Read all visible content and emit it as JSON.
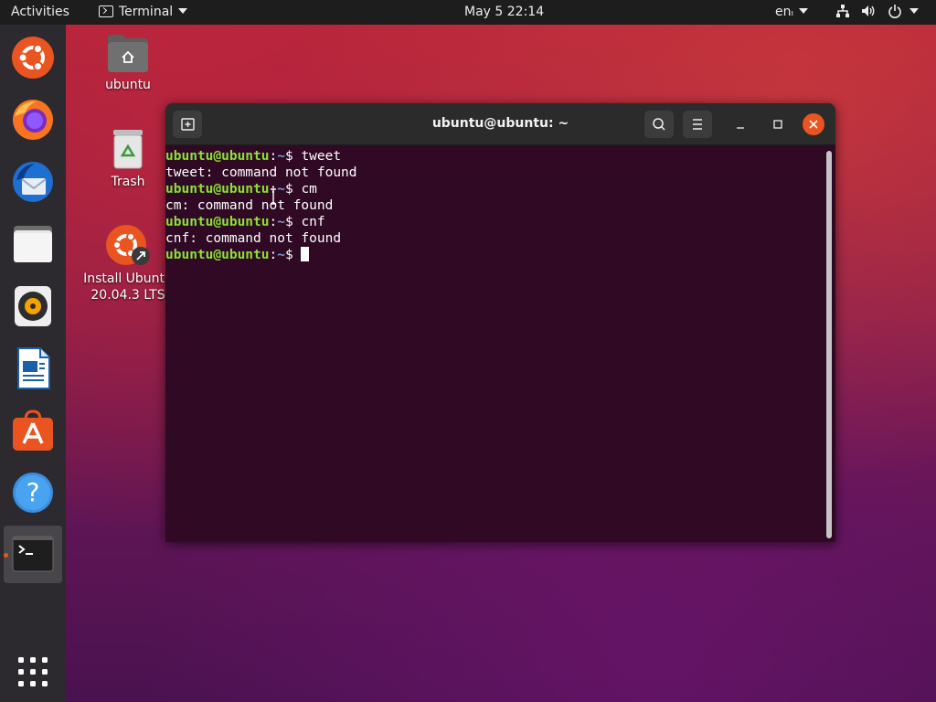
{
  "topbar": {
    "activities": "Activities",
    "app_name": "Terminal",
    "clock": "May 5  22:14",
    "language": "en"
  },
  "dock": {
    "items": [
      "ubuntu-software-icon",
      "firefox-icon",
      "thunderbird-icon",
      "files-icon",
      "rhythmbox-icon",
      "libreoffice-writer-icon",
      "ubuntu-software-center-icon",
      "help-icon",
      "terminal-icon",
      "show-applications-icon"
    ]
  },
  "desktop": {
    "home_label": "ubuntu",
    "trash_label": "Trash",
    "installer_label_line1": "Install Ubuntu",
    "installer_label_line2": "20.04.3 LTS"
  },
  "terminal": {
    "title": "ubuntu@ubuntu: ~",
    "prompt_user": "ubuntu@ubuntu",
    "prompt_path": "~",
    "lines": [
      {
        "type": "prompt",
        "command": "tweet"
      },
      {
        "type": "output",
        "text": "tweet: command not found"
      },
      {
        "type": "prompt",
        "command": "cm"
      },
      {
        "type": "output",
        "text": "cm: command not found"
      },
      {
        "type": "prompt",
        "command": "cnf"
      },
      {
        "type": "output",
        "text": "cnf: command not found"
      },
      {
        "type": "prompt",
        "command": ""
      }
    ]
  },
  "colors": {
    "accent": "#e95420",
    "terminal_bg": "#300a24",
    "prompt_user": "#8ae234",
    "prompt_path": "#729fcf"
  }
}
